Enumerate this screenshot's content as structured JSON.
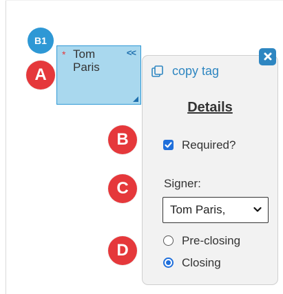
{
  "markers": {
    "b1": "B1",
    "a": "A",
    "b": "B",
    "c": "C",
    "d": "D"
  },
  "signature_tag": {
    "required_mark": "*",
    "signer_name": "Tom Paris",
    "collapse_icon": "collapse-double-chevron-left-icon",
    "collapse_text": "<<",
    "resize_icon": "resize-handle-icon"
  },
  "details_panel": {
    "close_icon": "close-x-icon",
    "copy_tag": {
      "icon": "copy-icon",
      "label": "copy tag"
    },
    "title": "Details",
    "required": {
      "label": "Required?",
      "checked": true
    },
    "signer": {
      "label": "Signer:",
      "selected": "Tom Paris,"
    },
    "timing_options": [
      {
        "label": "Pre-closing",
        "selected": false
      },
      {
        "label": "Closing",
        "selected": true
      }
    ]
  },
  "colors": {
    "marker_blue": "#2e98d5",
    "marker_red": "#e5383b",
    "tag_fill": "#a9d8ee",
    "accent_blue": "#2e86c1",
    "control_blue": "#1f6fdb"
  }
}
